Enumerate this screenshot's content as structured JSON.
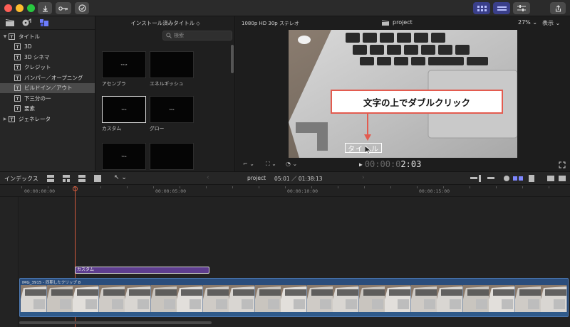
{
  "window": {
    "title": "project"
  },
  "sidebar": {
    "items": [
      {
        "label": "タイトル",
        "level": 0,
        "expanded": true,
        "selected": false
      },
      {
        "label": "3D",
        "level": 1,
        "selected": false
      },
      {
        "label": "3D シネマ",
        "level": 1,
        "selected": false
      },
      {
        "label": "クレジット",
        "level": 1,
        "selected": false
      },
      {
        "label": "バンパー／オープニング",
        "level": 1,
        "selected": false
      },
      {
        "label": "ビルドイン／アウト",
        "level": 1,
        "selected": true
      },
      {
        "label": "下三分の一",
        "level": 1,
        "selected": false
      },
      {
        "label": "要素",
        "level": 1,
        "selected": false
      },
      {
        "label": "ジェネレータ",
        "level": 0,
        "expanded": false,
        "selected": false
      }
    ]
  },
  "browser": {
    "header": "インストール済みタイトル",
    "search_placeholder": "検索",
    "thumbnails": [
      {
        "label": "アセンブラ",
        "t1": "TITLE",
        "t2": ""
      },
      {
        "label": "エネルギッシュ",
        "t1": "",
        "t2": ""
      },
      {
        "label": "カスタム",
        "t1": "Title",
        "t2": ""
      },
      {
        "label": "グロー",
        "t1": "Title",
        "t2": ""
      },
      {
        "label": "",
        "t1": "Title",
        "t2": ""
      },
      {
        "label": "",
        "t1": "",
        "t2": ""
      }
    ]
  },
  "viewer": {
    "format": "1080p HD 30p ステレオ",
    "project": "project",
    "zoom": "27%",
    "display": "表示",
    "timecode_dim": "00:00:0",
    "timecode_bright": "2:03",
    "callout": "文字の上でダブルクリック",
    "title_text": "タイトル"
  },
  "timeline": {
    "index_label": "インデックス",
    "project": "project",
    "time": "05:01 ／ 01:38:13",
    "ruler": [
      "00:00:00:00",
      "00:00:05:00",
      "00:00:10:00",
      "00:00:15:00"
    ],
    "title_clip": "カスタム",
    "video_clip": "IMG_3915 - 同期したクリップ 8"
  }
}
